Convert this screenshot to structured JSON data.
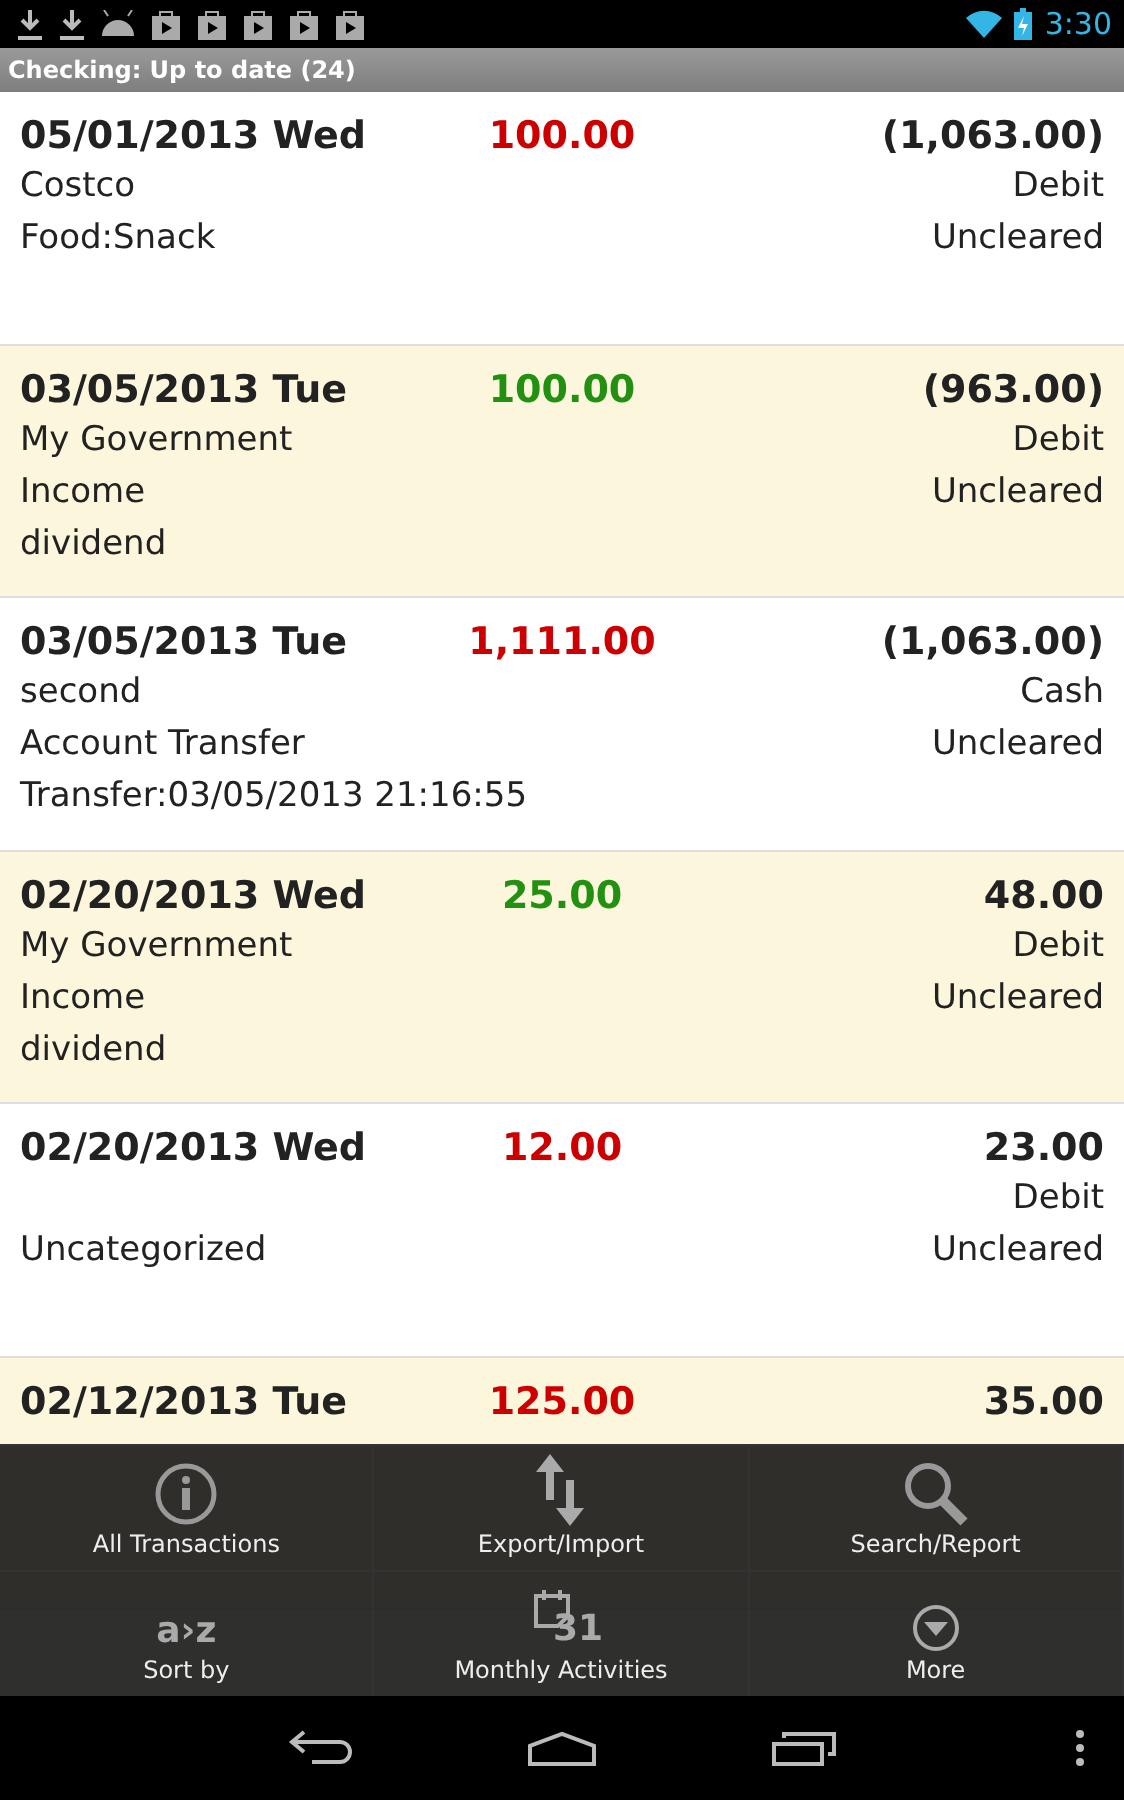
{
  "status_bar": {
    "time": "3:30"
  },
  "header": {
    "title": "Checking: Up to date (24)"
  },
  "transactions": [
    {
      "date": "05/01/2013 Wed",
      "amount": "100.00",
      "kind": "withdrawal",
      "balance": "(1,063.00)",
      "payee": "Costco",
      "category": "Food:Snack",
      "type": "Debit",
      "status": "Uncleared"
    },
    {
      "date": "03/05/2013 Tue",
      "amount": "100.00",
      "kind": "deposit",
      "balance": "(963.00)",
      "payee": "My Government",
      "category": "Income",
      "memo": "dividend",
      "type": "Debit",
      "status": "Uncleared"
    },
    {
      "date": "03/05/2013 Tue",
      "amount": "1,111.00",
      "kind": "withdrawal",
      "balance": "(1,063.00)",
      "payee": "second",
      "category": "Account Transfer",
      "memo": "Transfer:03/05/2013 21:16:55",
      "type": "Cash",
      "status": "Uncleared"
    },
    {
      "date": "02/20/2013 Wed",
      "amount": "25.00",
      "kind": "deposit",
      "balance": "48.00",
      "payee": "My Government",
      "category": "Income",
      "memo": "dividend",
      "type": "Debit",
      "status": "Uncleared"
    },
    {
      "date": "02/20/2013 Wed",
      "amount": "12.00",
      "kind": "withdrawal",
      "balance": "23.00",
      "category": "Uncategorized",
      "type": "Debit",
      "status": "Uncleared"
    },
    {
      "date": "02/12/2013 Tue",
      "amount": "125.00",
      "kind": "withdrawal",
      "balance": "35.00"
    }
  ],
  "menu": [
    {
      "label": "All Transactions"
    },
    {
      "label": "Export/Import"
    },
    {
      "label": "Search/Report"
    },
    {
      "label": "Sort by",
      "glyph": "a›z"
    },
    {
      "label": "Monthly Activities",
      "glyph": "31"
    },
    {
      "label": "More"
    }
  ]
}
